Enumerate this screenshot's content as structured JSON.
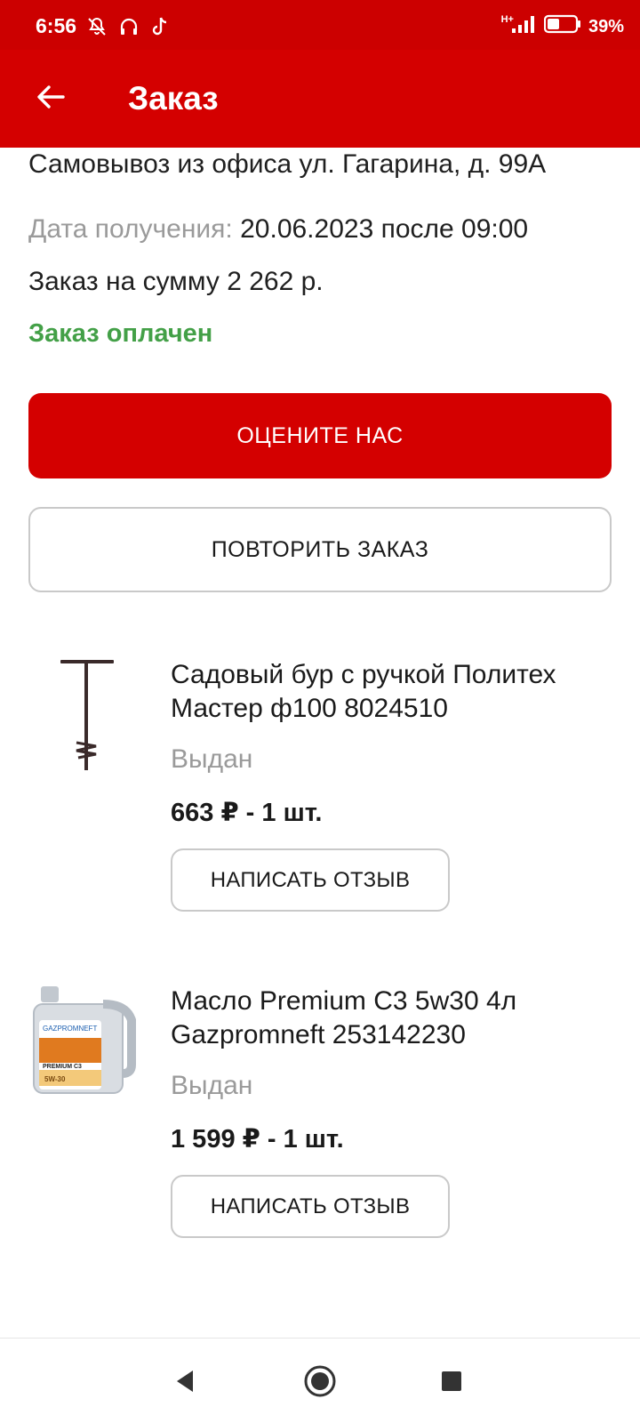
{
  "status_bar": {
    "time": "6:56",
    "battery_percent": "39%",
    "network": "H+",
    "icons": [
      "mute-icon",
      "headphones-icon",
      "tiktok-icon",
      "signal-icon",
      "battery-icon"
    ]
  },
  "app_bar": {
    "title": "Заказ",
    "back_icon": "arrow-left-icon"
  },
  "order": {
    "pickup": "Самовывоз из офиса ул. Гагарина, д. 99А",
    "date_label": "Дата получения:",
    "date_value": "20.06.2023 после 09:00",
    "sum": "Заказ на сумму 2 262 р.",
    "paid_status": "Заказ оплачен"
  },
  "buttons": {
    "rate": "ОЦЕНИТЕ НАС",
    "repeat": "ПОВТОРИТЬ ЗАКАЗ"
  },
  "items": [
    {
      "name": "Садовый бур с ручкой Политех Мастер ф100 8024510",
      "status": "Выдан",
      "price": "663 ₽ - 1 шт.",
      "review_label": "НАПИСАТЬ ОТЗЫВ",
      "image_icon": "garden-auger-image"
    },
    {
      "name": "Масло Premium С3 5w30 4л Gazpromneft 253142230",
      "status": "Выдан",
      "price": "1 599 ₽ - 1 шт.",
      "review_label": "НАПИСАТЬ ОТЗЫВ",
      "image_icon": "oil-canister-image",
      "image_labels": [
        "GAZPROMNEFT",
        "PREMIUM C3",
        "5W-30"
      ]
    }
  ],
  "colors": {
    "brand_red": "#d40000",
    "status_green": "#43a047",
    "muted_gray": "#9a9a9a"
  }
}
